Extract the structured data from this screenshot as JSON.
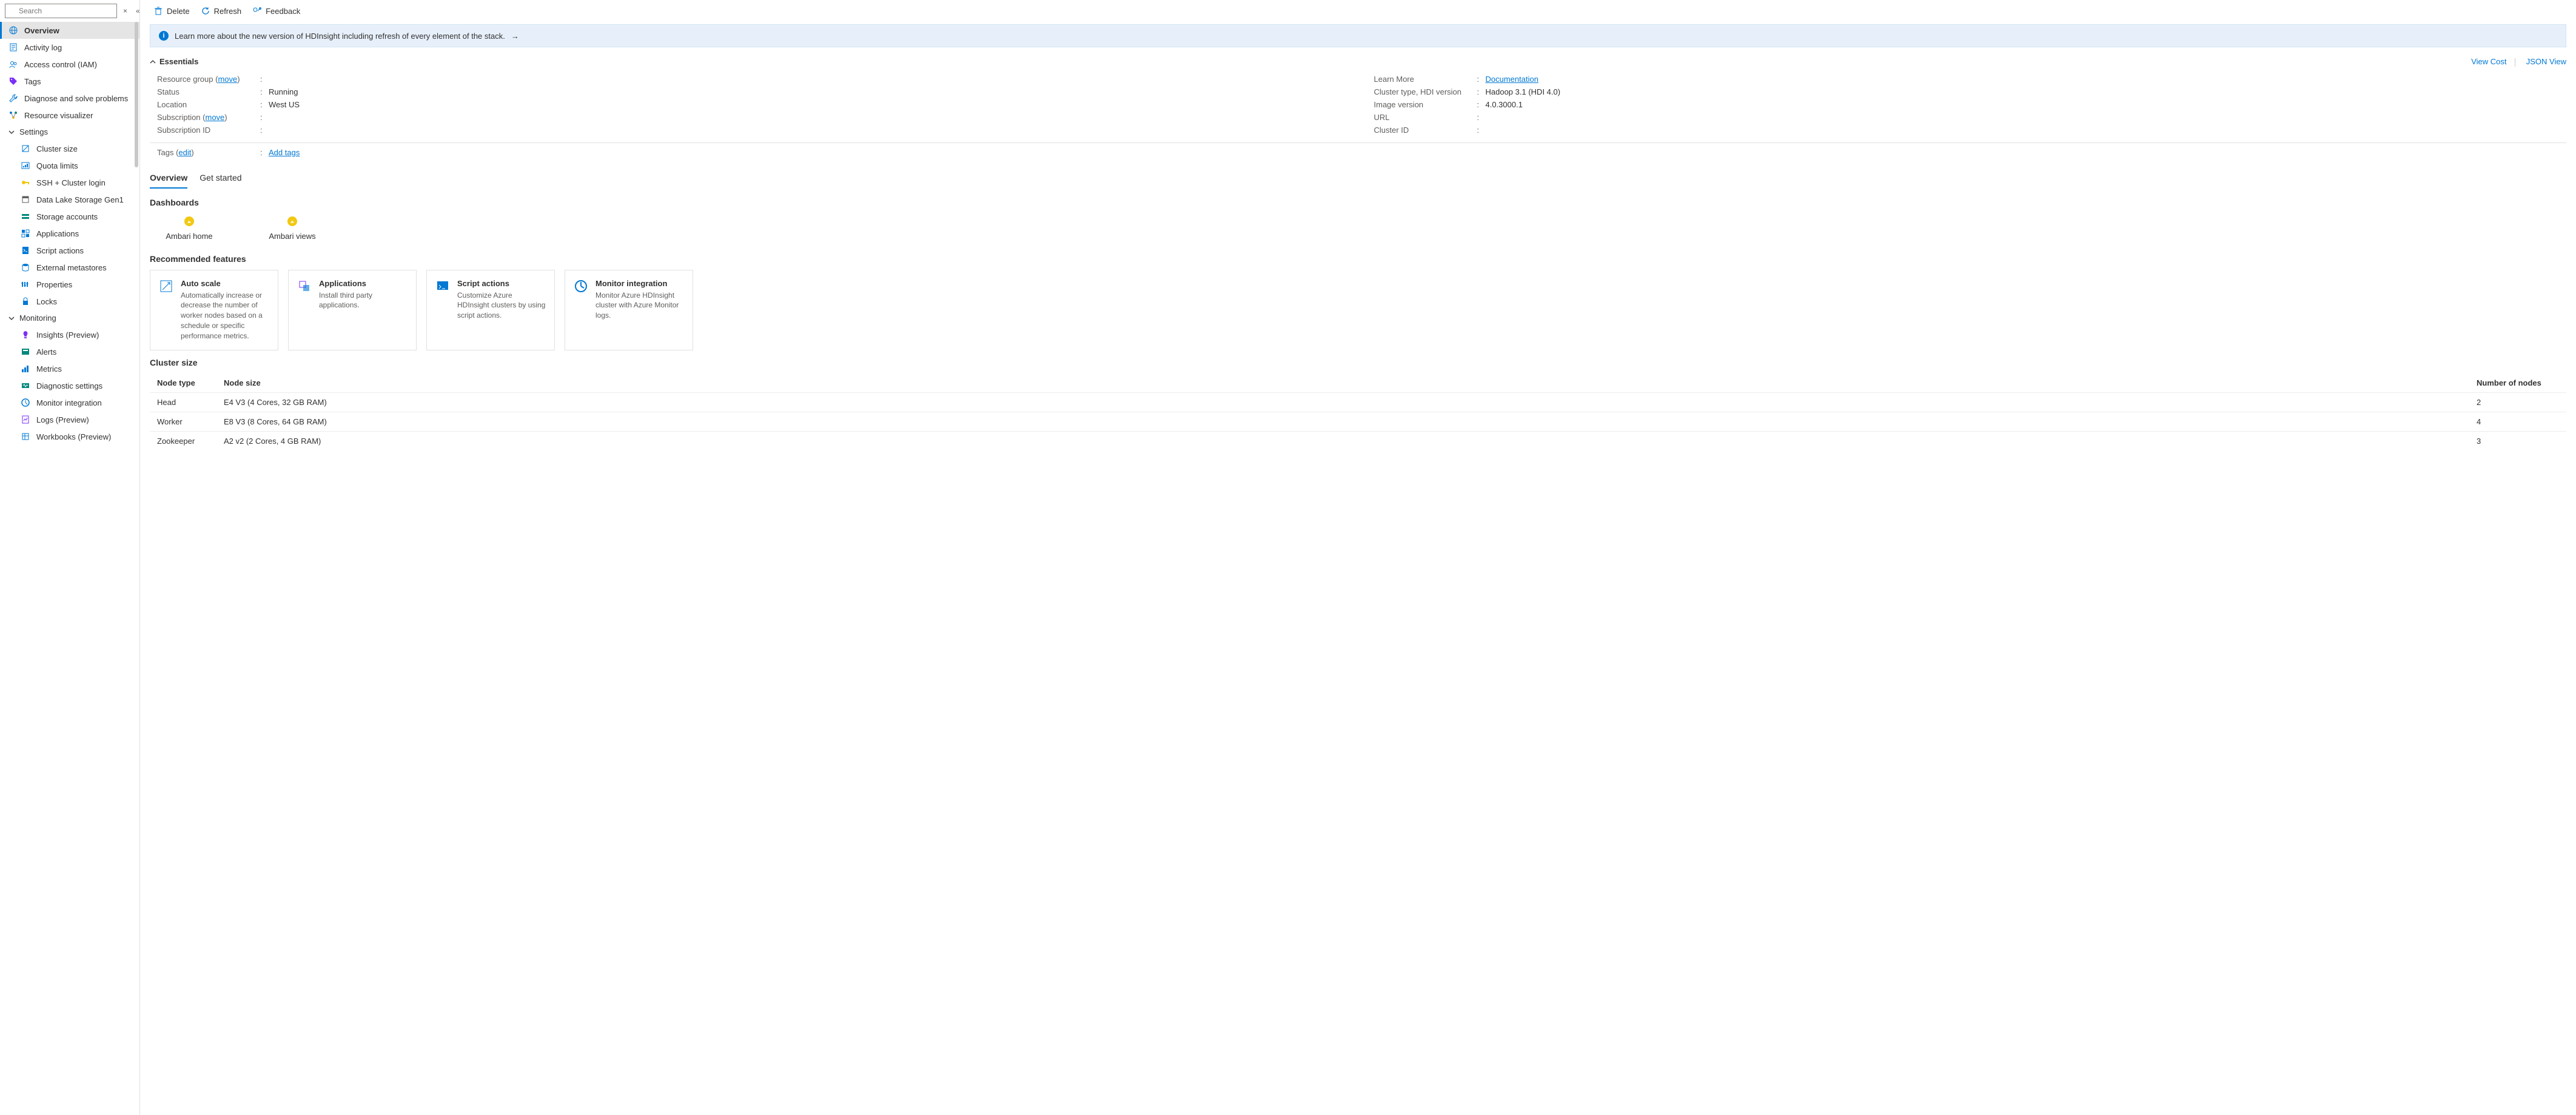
{
  "search": {
    "placeholder": "Search"
  },
  "sidebar": {
    "collapse_x": "×",
    "collapse_chev": "«",
    "items": [
      {
        "label": "Overview",
        "icon": "globe",
        "active": true
      },
      {
        "label": "Activity log",
        "icon": "log"
      },
      {
        "label": "Access control (IAM)",
        "icon": "people"
      },
      {
        "label": "Tags",
        "icon": "tag"
      },
      {
        "label": "Diagnose and solve problems",
        "icon": "wrench"
      },
      {
        "label": "Resource visualizer",
        "icon": "viz"
      }
    ],
    "settings_label": "Settings",
    "settings": [
      {
        "label": "Cluster size",
        "icon": "scale"
      },
      {
        "label": "Quota limits",
        "icon": "quota"
      },
      {
        "label": "SSH + Cluster login",
        "icon": "key"
      },
      {
        "label": "Data Lake Storage Gen1",
        "icon": "datalake"
      },
      {
        "label": "Storage accounts",
        "icon": "storage"
      },
      {
        "label": "Applications",
        "icon": "apps"
      },
      {
        "label": "Script actions",
        "icon": "script"
      },
      {
        "label": "External metastores",
        "icon": "metastore"
      },
      {
        "label": "Properties",
        "icon": "props"
      },
      {
        "label": "Locks",
        "icon": "lock"
      }
    ],
    "monitoring_label": "Monitoring",
    "monitoring": [
      {
        "label": "Insights (Preview)",
        "icon": "bulb"
      },
      {
        "label": "Alerts",
        "icon": "alerts"
      },
      {
        "label": "Metrics",
        "icon": "metrics"
      },
      {
        "label": "Diagnostic settings",
        "icon": "diag"
      },
      {
        "label": "Monitor integration",
        "icon": "monitor"
      },
      {
        "label": "Logs (Preview)",
        "icon": "logs"
      },
      {
        "label": "Workbooks (Preview)",
        "icon": "workbook"
      }
    ]
  },
  "toolbar": {
    "delete": "Delete",
    "refresh": "Refresh",
    "feedback": "Feedback"
  },
  "banner": {
    "text": "Learn more about the new version of HDInsight including refresh of every element of the stack.",
    "arrow": "→"
  },
  "essentials": {
    "title": "Essentials",
    "view_cost": "View Cost",
    "json_view": "JSON View",
    "left": [
      {
        "label": "Resource group",
        "link": "move",
        "value": ""
      },
      {
        "label": "Status",
        "value": "Running"
      },
      {
        "label": "Location",
        "value": "West US"
      },
      {
        "label": "Subscription",
        "link": "move",
        "value": ""
      },
      {
        "label": "Subscription ID",
        "value": ""
      }
    ],
    "right": [
      {
        "label": "Learn More",
        "value_link": "Documentation"
      },
      {
        "label": "Cluster type, HDI version",
        "value": "Hadoop 3.1 (HDI 4.0)"
      },
      {
        "label": "Image version",
        "value": "4.0.3000.1"
      },
      {
        "label": "URL",
        "value": ""
      },
      {
        "label": "Cluster ID",
        "value": ""
      }
    ],
    "tags_label": "Tags",
    "tags_edit": "edit",
    "add_tags": "Add tags"
  },
  "tabs": {
    "overview": "Overview",
    "get_started": "Get started"
  },
  "dashboards": {
    "title": "Dashboards",
    "items": [
      {
        "label": "Ambari home"
      },
      {
        "label": "Ambari views"
      }
    ]
  },
  "features": {
    "title": "Recommended features",
    "cards": [
      {
        "title": "Auto scale",
        "desc": "Automatically increase or decrease the number of worker nodes based on a schedule or specific performance metrics."
      },
      {
        "title": "Applications",
        "desc": "Install third party applications."
      },
      {
        "title": "Script actions",
        "desc": "Customize Azure HDInsight clusters by using script actions."
      },
      {
        "title": "Monitor integration",
        "desc": "Monitor Azure HDInsight cluster with Azure Monitor logs."
      }
    ]
  },
  "cluster": {
    "title": "Cluster size",
    "headers": {
      "type": "Node type",
      "size": "Node size",
      "count": "Number of nodes"
    },
    "rows": [
      {
        "type": "Head",
        "size": "E4 V3 (4 Cores, 32 GB RAM)",
        "count": "2"
      },
      {
        "type": "Worker",
        "size": "E8 V3 (8 Cores, 64 GB RAM)",
        "count": "4"
      },
      {
        "type": "Zookeeper",
        "size": "A2 v2 (2 Cores, 4 GB RAM)",
        "count": "3"
      }
    ]
  }
}
